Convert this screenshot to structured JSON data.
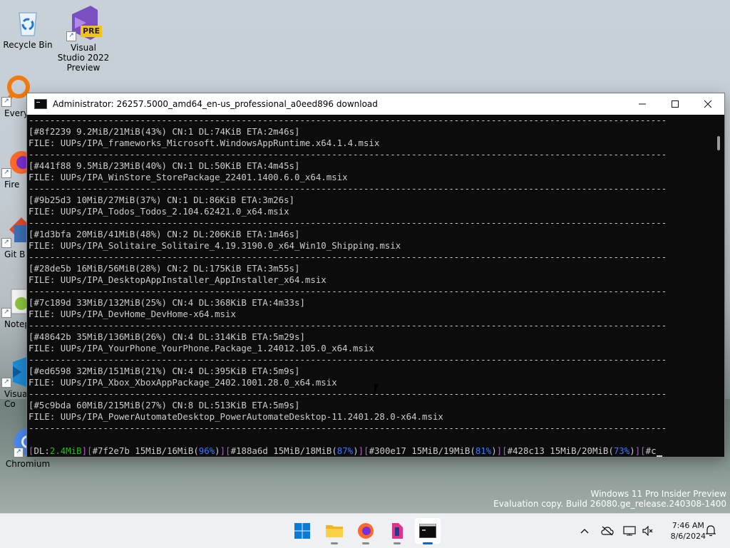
{
  "desktop": {
    "icons": [
      {
        "label": "Recycle Bin"
      },
      {
        "label": "Visual Studio 2022 Preview",
        "badge": "PRE"
      },
      {
        "label": "Every"
      },
      {
        "label": "Fire"
      },
      {
        "label": "Git B"
      },
      {
        "label": "Notep"
      },
      {
        "label": "Visual Co"
      },
      {
        "label": "Chromium"
      }
    ]
  },
  "window": {
    "title": "Administrator:  26257.5000_amd64_en-us_professional_a0eed896 download",
    "controls": {
      "minimize": "—",
      "maximize": "☐",
      "close": "✕"
    }
  },
  "console": {
    "lines": [
      "------------------------------------------------------------------------------------------------------------------------",
      "[#8f2239 9.2MiB/21MiB(43%) CN:1 DL:74KiB ETA:2m46s]",
      "FILE: UUPs/IPA_frameworks_Microsoft.WindowsAppRuntime.x64.1.4.msix",
      "------------------------------------------------------------------------------------------------------------------------",
      "[#441f88 9.5MiB/23MiB(40%) CN:1 DL:50KiB ETA:4m45s]",
      "FILE: UUPs/IPA_WinStore_StorePackage_22401.1400.6.0_x64.msix",
      "------------------------------------------------------------------------------------------------------------------------",
      "[#9b25d3 10MiB/27MiB(37%) CN:1 DL:86KiB ETA:3m26s]",
      "FILE: UUPs/IPA_Todos_Todos_2.104.62421.0_x64.msix",
      "------------------------------------------------------------------------------------------------------------------------",
      "[#1d3bfa 20MiB/41MiB(48%) CN:2 DL:206KiB ETA:1m46s]",
      "FILE: UUPs/IPA_Solitaire_Solitaire_4.19.3190.0_x64_Win10_Shipping.msix",
      "------------------------------------------------------------------------------------------------------------------------",
      "[#28de5b 16MiB/56MiB(28%) CN:2 DL:175KiB ETA:3m55s]",
      "FILE: UUPs/IPA_DesktopAppInstaller_AppInstaller_x64.msix",
      "------------------------------------------------------------------------------------------------------------------------",
      "[#7c189d 33MiB/132MiB(25%) CN:4 DL:368KiB ETA:4m33s]",
      "FILE: UUPs/IPA_DevHome_DevHome-x64.msix",
      "------------------------------------------------------------------------------------------------------------------------",
      "[#48642b 35MiB/136MiB(26%) CN:4 DL:314KiB ETA:5m29s]",
      "FILE: UUPs/IPA_YourPhone_YourPhone.Package_1.24012.105.0_x64.msix",
      "------------------------------------------------------------------------------------------------------------------------",
      "[#ed6598 32MiB/151MiB(21%) CN:4 DL:395KiB ETA:5m9s]",
      "FILE: UUPs/IPA_Xbox_XboxAppPackage_2402.1001.28.0_x64.msix",
      "------------------------------------------------------------------------------------------------------------------------",
      "[#5c9bda 60MiB/215MiB(27%) CN:8 DL:513KiB ETA:5m9s]",
      "FILE: UUPs/IPA_PowerAutomateDesktop_PowerAutomateDesktop-11.2401.28.0-x64.msix",
      "------------------------------------------------------------------------------------------------------------------------",
      ""
    ],
    "status": {
      "dl_label": "DL:",
      "dl_value": "2.4MiB",
      "items": [
        {
          "id": "#7f2e7b",
          "size": "15MiB/16MiB",
          "pct": "96%"
        },
        {
          "id": "#188a6d",
          "size": "15MiB/18MiB",
          "pct": "87%"
        },
        {
          "id": "#300e17",
          "size": "15MiB/19MiB",
          "pct": "81%"
        },
        {
          "id": "#428c13",
          "size": "15MiB/20MiB",
          "pct": "73%"
        }
      ],
      "tail": "#c"
    }
  },
  "watermark": {
    "line1": "Windows 11 Pro Insider Preview",
    "line2": "Evaluation copy. Build 26080.ge_release.240308-1400"
  },
  "taskbar": {
    "apps": [
      {
        "name": "start-button",
        "icon": "windows-logo-icon"
      },
      {
        "name": "file-explorer",
        "icon": "folder-icon"
      },
      {
        "name": "firefox",
        "icon": "firefox-icon"
      },
      {
        "name": "notion-like-app",
        "icon": "app-icon"
      },
      {
        "name": "terminal",
        "icon": "terminal-icon"
      }
    ],
    "clock": {
      "time": "7:46 AM",
      "date": "8/6/2024"
    }
  },
  "colors": {
    "console_bg": "#0c0c0c",
    "console_fg": "#cccccc",
    "accent_blue": "#0a64c9"
  }
}
